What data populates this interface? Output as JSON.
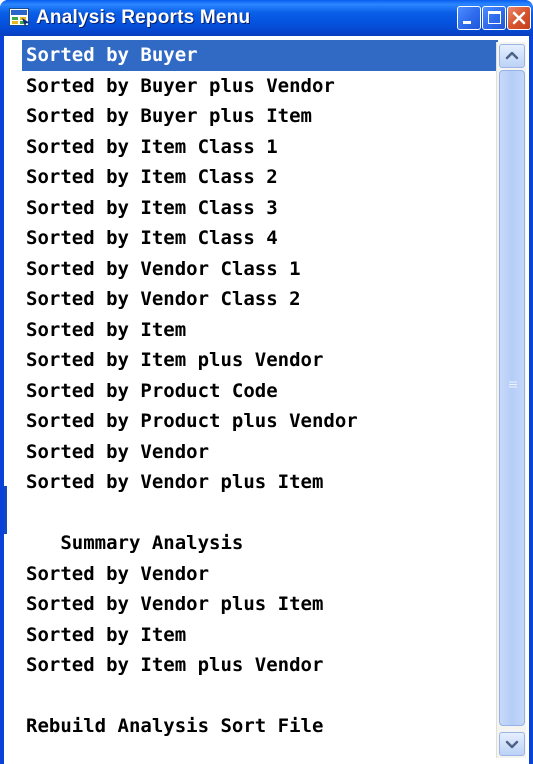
{
  "window": {
    "title": "Analysis Reports Menu",
    "controls": [
      "minimize",
      "maximize",
      "close"
    ]
  },
  "menu": {
    "selected_index": 0,
    "items": [
      "Sorted by Buyer",
      "Sorted by Buyer plus Vendor",
      "Sorted by Buyer plus Item",
      "Sorted by Item Class 1",
      "Sorted by Item Class 2",
      "Sorted by Item Class 3",
      "Sorted by Item Class 4",
      "Sorted by Vendor Class 1",
      "Sorted by Vendor Class 2",
      "Sorted by Item",
      "Sorted by Item plus Vendor",
      "Sorted by Product Code",
      "Sorted by Product plus Vendor",
      "Sorted by Vendor",
      "Sorted by Vendor plus Item",
      "",
      "   Summary Analysis",
      "Sorted by Vendor",
      "Sorted by Vendor plus Item",
      "Sorted by Item",
      "Sorted by Item plus Vendor",
      "",
      "Rebuild Analysis Sort File"
    ]
  },
  "icons": {
    "app": "report-menu-icon",
    "minimize": "minimize-icon",
    "maximize": "maximize-icon",
    "close": "close-icon",
    "scroll_up": "chevron-up-icon",
    "scroll_down": "chevron-down-icon"
  },
  "colors": {
    "titlebar": "#0554e0",
    "selection": "#316ac5",
    "close_button": "#d9552f"
  }
}
